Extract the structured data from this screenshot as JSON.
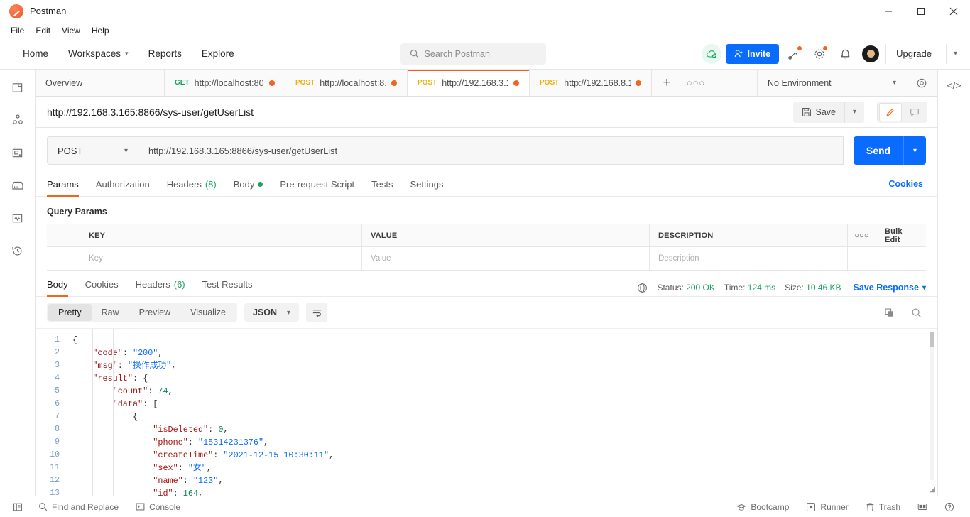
{
  "window": {
    "title": "Postman",
    "logo_icon": "postman-logo-icon",
    "minimize_icon": "minimize-icon",
    "maximize_icon": "maximize-icon",
    "close_icon": "close-icon"
  },
  "menubar": {
    "items": [
      "File",
      "Edit",
      "View",
      "Help"
    ]
  },
  "topnav": {
    "items": [
      {
        "label": "Home",
        "chevron": false
      },
      {
        "label": "Workspaces",
        "chevron": true
      },
      {
        "label": "Reports",
        "chevron": false
      },
      {
        "label": "Explore",
        "chevron": false
      }
    ],
    "search_placeholder": "Search Postman",
    "invite_label": "Invite",
    "upgrade_label": "Upgrade"
  },
  "rail": {
    "items": [
      {
        "name": "collections-icon"
      },
      {
        "name": "apis-icon"
      },
      {
        "name": "environments-icon"
      },
      {
        "name": "mock-servers-icon"
      },
      {
        "name": "monitors-icon"
      },
      {
        "name": "history-icon"
      }
    ]
  },
  "tabs": {
    "items": [
      {
        "method": "",
        "label": "Overview",
        "active": false,
        "unsaved": false
      },
      {
        "method": "GET",
        "label": "http://localhost:80...",
        "active": false,
        "unsaved": true
      },
      {
        "method": "POST",
        "label": "http://localhost:8...",
        "active": false,
        "unsaved": true
      },
      {
        "method": "POST",
        "label": "http://192.168.3.1...",
        "active": true,
        "unsaved": true
      },
      {
        "method": "POST",
        "label": "http://192.168.8.1...",
        "active": false,
        "unsaved": true
      }
    ],
    "add_label": "+",
    "more_label": "○○○",
    "environment": "No Environment"
  },
  "request_header": {
    "title": "http://192.168.3.165:8866/sys-user/getUserList",
    "save_label": "Save"
  },
  "urlbar": {
    "method": "POST",
    "url": "http://192.168.3.165:8866/sys-user/getUserList",
    "send_label": "Send"
  },
  "request_tabs": {
    "items": [
      {
        "label": "Params",
        "count": "",
        "dot": false,
        "active": true
      },
      {
        "label": "Authorization",
        "count": "",
        "dot": false,
        "active": false
      },
      {
        "label": "Headers",
        "count": "(8)",
        "dot": false,
        "active": false
      },
      {
        "label": "Body",
        "count": "",
        "dot": true,
        "active": false
      },
      {
        "label": "Pre-request Script",
        "count": "",
        "dot": false,
        "active": false
      },
      {
        "label": "Tests",
        "count": "",
        "dot": false,
        "active": false
      },
      {
        "label": "Settings",
        "count": "",
        "dot": false,
        "active": false
      }
    ],
    "cookies_link": "Cookies"
  },
  "params": {
    "section_label": "Query Params",
    "headers": [
      "KEY",
      "VALUE",
      "DESCRIPTION"
    ],
    "more_label": "○○○",
    "bulk_edit_label": "Bulk Edit",
    "row_placeholders": [
      "Key",
      "Value",
      "Description"
    ]
  },
  "response": {
    "tabs": [
      {
        "label": "Body",
        "count": "",
        "active": true
      },
      {
        "label": "Cookies",
        "count": "",
        "active": false
      },
      {
        "label": "Headers",
        "count": "(6)",
        "active": false
      },
      {
        "label": "Test Results",
        "count": "",
        "active": false
      }
    ],
    "status_label": "Status:",
    "status_value": "200 OK",
    "time_label": "Time:",
    "time_value": "124 ms",
    "size_label": "Size:",
    "size_value": "10.46 KB",
    "save_response_label": "Save Response",
    "view_modes": [
      "Pretty",
      "Raw",
      "Preview",
      "Visualize"
    ],
    "active_view": "Pretty",
    "format": "JSON",
    "copy_icon": "copy-icon",
    "search_icon": "search-icon"
  },
  "json_viewer": {
    "line_numbers": [
      "1",
      "2",
      "3",
      "4",
      "5",
      "6",
      "7",
      "8",
      "9",
      "10",
      "11",
      "12",
      "13"
    ],
    "lines": [
      {
        "indent": 0,
        "tokens": [
          {
            "t": "p",
            "v": "{"
          }
        ]
      },
      {
        "indent": 1,
        "tokens": [
          {
            "t": "k",
            "v": "\"code\""
          },
          {
            "t": "p",
            "v": ": "
          },
          {
            "t": "s",
            "v": "\"200\""
          },
          {
            "t": "p",
            "v": ","
          }
        ]
      },
      {
        "indent": 1,
        "tokens": [
          {
            "t": "k",
            "v": "\"msg\""
          },
          {
            "t": "p",
            "v": ": "
          },
          {
            "t": "s",
            "v": "\"操作成功\""
          },
          {
            "t": "p",
            "v": ","
          }
        ]
      },
      {
        "indent": 1,
        "tokens": [
          {
            "t": "k",
            "v": "\"result\""
          },
          {
            "t": "p",
            "v": ": {"
          }
        ]
      },
      {
        "indent": 2,
        "tokens": [
          {
            "t": "k",
            "v": "\"count\""
          },
          {
            "t": "p",
            "v": ": "
          },
          {
            "t": "n",
            "v": "74"
          },
          {
            "t": "p",
            "v": ","
          }
        ]
      },
      {
        "indent": 2,
        "tokens": [
          {
            "t": "k",
            "v": "\"data\""
          },
          {
            "t": "p",
            "v": ": ["
          }
        ]
      },
      {
        "indent": 3,
        "tokens": [
          {
            "t": "p",
            "v": "{"
          }
        ]
      },
      {
        "indent": 4,
        "tokens": [
          {
            "t": "k",
            "v": "\"isDeleted\""
          },
          {
            "t": "p",
            "v": ": "
          },
          {
            "t": "n",
            "v": "0"
          },
          {
            "t": "p",
            "v": ","
          }
        ]
      },
      {
        "indent": 4,
        "tokens": [
          {
            "t": "k",
            "v": "\"phone\""
          },
          {
            "t": "p",
            "v": ": "
          },
          {
            "t": "s",
            "v": "\"15314231376\""
          },
          {
            "t": "p",
            "v": ","
          }
        ]
      },
      {
        "indent": 4,
        "tokens": [
          {
            "t": "k",
            "v": "\"createTime\""
          },
          {
            "t": "p",
            "v": ": "
          },
          {
            "t": "s",
            "v": "\"2021-12-15 10:30:11\""
          },
          {
            "t": "p",
            "v": ","
          }
        ]
      },
      {
        "indent": 4,
        "tokens": [
          {
            "t": "k",
            "v": "\"sex\""
          },
          {
            "t": "p",
            "v": ": "
          },
          {
            "t": "s",
            "v": "\"女\""
          },
          {
            "t": "p",
            "v": ","
          }
        ]
      },
      {
        "indent": 4,
        "tokens": [
          {
            "t": "k",
            "v": "\"name\""
          },
          {
            "t": "p",
            "v": ": "
          },
          {
            "t": "s",
            "v": "\"123\""
          },
          {
            "t": "p",
            "v": ","
          }
        ]
      },
      {
        "indent": 4,
        "tokens": [
          {
            "t": "k",
            "v": "\"id\""
          },
          {
            "t": "p",
            "v": ": "
          },
          {
            "t": "n",
            "v": "164"
          },
          {
            "t": "p",
            "v": ","
          }
        ]
      }
    ]
  },
  "statusbar": {
    "left": [
      {
        "label": "Find and Replace",
        "icon": "search-icon"
      },
      {
        "label": "Console",
        "icon": "console-icon"
      }
    ],
    "right": [
      {
        "label": "Bootcamp",
        "icon": "bootcamp-icon"
      },
      {
        "label": "Runner",
        "icon": "runner-icon"
      },
      {
        "label": "Trash",
        "icon": "trash-icon"
      }
    ],
    "layout_icon": "two-pane-icon",
    "help_icon": "help-icon"
  },
  "colors": {
    "accent": "#f1651f",
    "blue": "#0a6cff",
    "green": "#1aa260",
    "orange": "#f0ad00"
  }
}
